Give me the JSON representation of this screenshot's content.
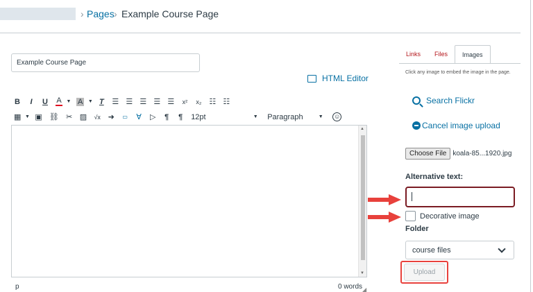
{
  "breadcrumb": {
    "sep": "›",
    "pages": "Pages",
    "current": "Example Course Page"
  },
  "editor": {
    "title_value": "Example Course Page",
    "html_editor_label": "HTML Editor",
    "font_size": "12pt",
    "block_format": "Paragraph",
    "status_element": "p",
    "word_count": "0 words"
  },
  "toolbar": {
    "bold": "B",
    "italic": "I",
    "underline": "U",
    "text_color": "A",
    "bg_color": "A",
    "clear_format": "T",
    "superscript": "x²",
    "subscript": "x₂",
    "sqrt": "√x",
    "ltr": "¶",
    "rtl": "¶"
  },
  "panel": {
    "tabs": [
      {
        "label": "Links"
      },
      {
        "label": "Files"
      },
      {
        "label": "Images"
      }
    ],
    "hint": "Click any image to embed the image in the page.",
    "search_flickr": "Search Flickr",
    "cancel_upload": "Cancel image upload",
    "choose_file": "Choose File",
    "file_name": "koala-85...1920.jpg",
    "alt_text_label": "Alternative text:",
    "decorative_label": "Decorative image",
    "folder_label": "Folder",
    "folder_value": "course files",
    "upload_label": "Upload"
  },
  "colors": {
    "link": "#0770a3",
    "tab_inactive": "#b4161b",
    "highlight": "#e8413c",
    "alt_border": "#7a1a22"
  }
}
